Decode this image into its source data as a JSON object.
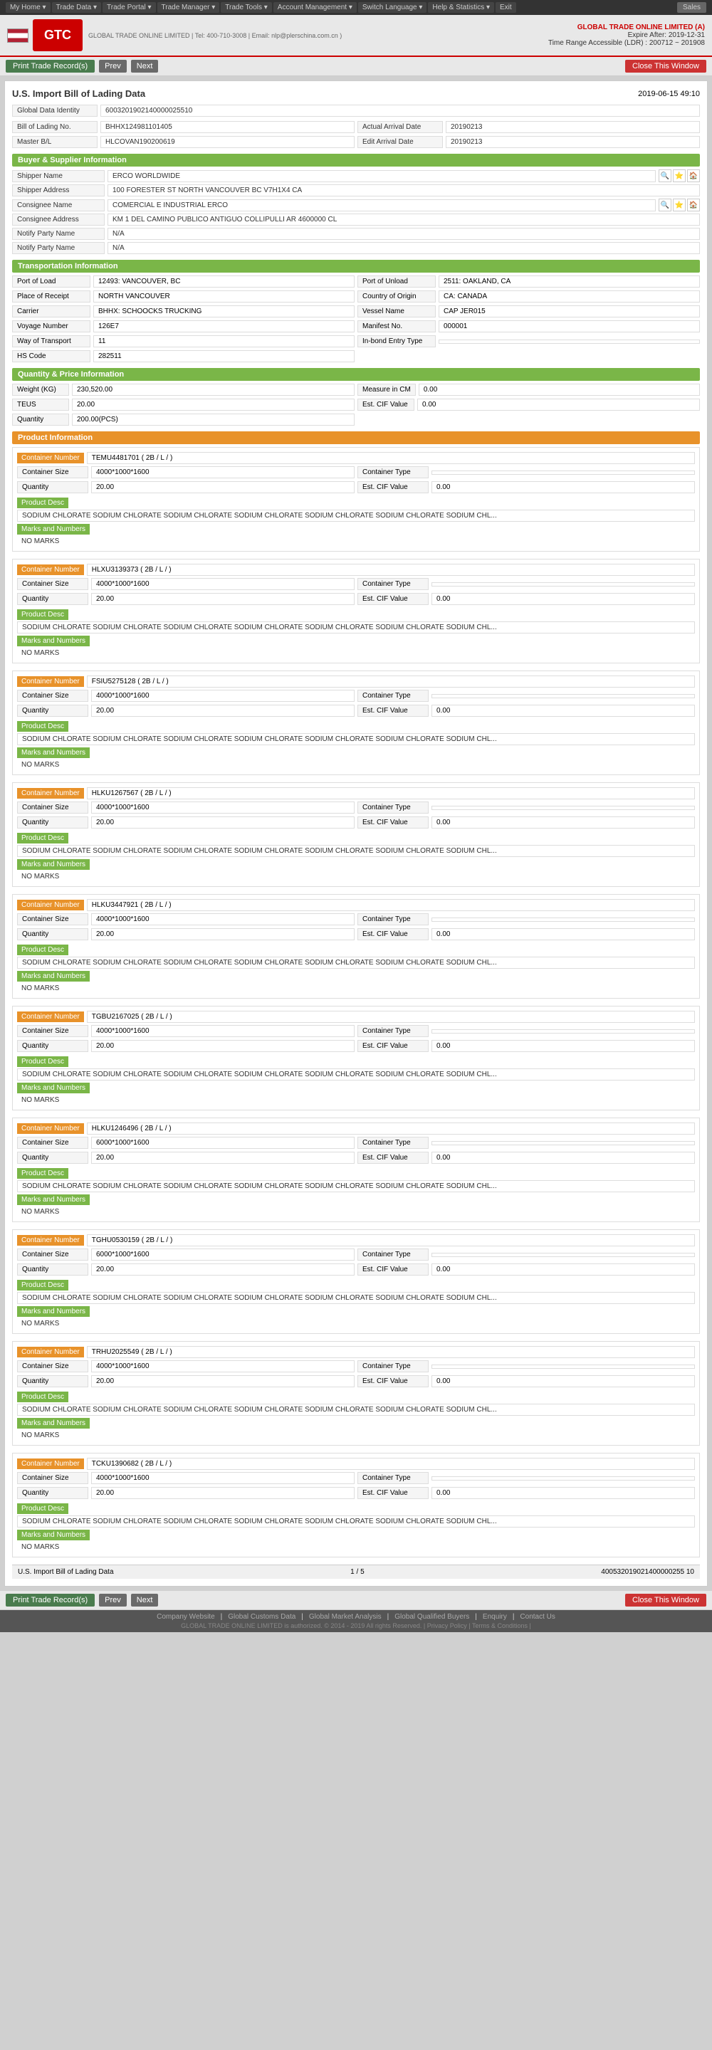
{
  "topNav": {
    "items": [
      "My Home",
      "Trade Data",
      "Trade Portal",
      "Trade Manager",
      "Trade Tools",
      "Account Management",
      "Switch Language",
      "Help & Statistics",
      "Exit"
    ],
    "sales": "Sales"
  },
  "header": {
    "companyName": "GLOBAL TRADE ONLINE LIMITED (A)",
    "expiry": "Expire After: 2019-12-31",
    "timeRange": "Time Range Accessible (LDR) : 200712 ~ 201908",
    "logo": "GTC",
    "companyFull": "GLOBAL TRADE ONLINE LIMITED | Tel: 400-710-3008 | Email: nlp@plerschina.com.cn )"
  },
  "pageTitle": "U.S. Import Bill of Lading Data",
  "toolbar": {
    "printLabel": "Print Trade Record(s)",
    "prevLabel": "Prev",
    "nextLabel": "Next",
    "closeLabel": "Close This Window"
  },
  "meta": {
    "date": "2019-06-15 49:10",
    "globalDataId": "6003201902140000025510"
  },
  "billInfo": {
    "billLabel": "Bill of Lading No.",
    "billValue": "BHHX124981101405",
    "masterLabel": "Master B/L",
    "masterValue": "HLCOVAN190200619",
    "actualArrivalLabel": "Actual Arrival Date",
    "actualArrivalValue": "20190213",
    "editArrivalLabel": "Edit Arrival Date",
    "editArrivalValue": "20190213"
  },
  "buyerSupplier": {
    "title": "Buyer & Supplier Information",
    "shipperLabel": "Shipper Name",
    "shipperValue": "ERCO WORLDWIDE",
    "shipperAddressLabel": "Shipper Address",
    "shipperAddressValue": "100 FORESTER ST NORTH VANCOUVER BC V7H1X4 CA",
    "consigneeLabel": "Consignee Name",
    "consigneeValue": "COMERCIAL E INDUSTRIAL ERCO",
    "consigneeAddressLabel": "Consignee Address",
    "consigneeAddressValue": "KM 1 DEL CAMINO PUBLICO ANTIGUO COLLIPULLI AR 4600000 CL",
    "notifyPartyLabel": "Notify Party Name",
    "notifyPartyValue": "N/A",
    "notifyParty2Label": "Notify Party Name",
    "notifyParty2Value": "N/A"
  },
  "transportation": {
    "title": "Transportation Information",
    "portLoadLabel": "Port of Load",
    "portLoadValue": "12493: VANCOUVER, BC",
    "portUnloadLabel": "Port of Unload",
    "portUnloadValue": "2511: OAKLAND, CA",
    "placeReceiptLabel": "Place of Receipt",
    "placeReceiptValue": "NORTH VANCOUVER",
    "countryOriginLabel": "Country of Origin",
    "countryOriginValue": "CA: CANADA",
    "carrierLabel": "Carrier",
    "carrierValue": "BHHX: SCHOOCKS TRUCKING",
    "vesselLabel": "Vessel Name",
    "vesselValue": "CAP JER015",
    "voyageLabel": "Voyage Number",
    "voyageValue": "126E7",
    "manifestLabel": "Manifest No.",
    "manifestValue": "000001",
    "wayTransportLabel": "Way of Transport",
    "wayTransportValue": "11",
    "inBondLabel": "In-bond Entry Type",
    "inBondValue": "",
    "hsLabel": "HS Code",
    "hsValue": "282511"
  },
  "quantity": {
    "title": "Quantity & Price Information",
    "weightLabel": "Weight (KG)",
    "weightValue": "230,520.00",
    "measureLabel": "Measure in CM",
    "measureValue": "0.00",
    "teusLabel": "TEUS",
    "teusValue": "20.00",
    "estCfvLabel": "Est. CIF Value",
    "estCfvValue": "0.00",
    "quantityLabel": "Quantity",
    "quantityValue": "200.00(PCS)"
  },
  "productInfo": {
    "title": "Product Information",
    "containers": [
      {
        "id": 1,
        "containerNumberLabel": "Container Number",
        "containerNumberValue": "TEMU4481701 ( 2B / L / )",
        "containerSizeLabel": "Container Size",
        "containerSizeValue": "4000*1000*1600",
        "containerTypeLabel": "Container Type",
        "containerTypeValue": "",
        "quantityLabel": "Quantity",
        "quantityValue": "20.00",
        "estCifLabel": "Est. CIF Value",
        "estCifValue": "0.00",
        "productDescLabel": "Product Desc",
        "productDescValue": "SODIUM CHLORATE SODIUM CHLORATE SODIUM CHLORATE SODIUM CHLORATE SODIUM CHLORATE SODIUM CHLORATE SODIUM CHL...",
        "marksLabel": "Marks and Numbers",
        "marksValue": "NO MARKS"
      },
      {
        "id": 2,
        "containerNumberLabel": "Container Number",
        "containerNumberValue": "HLXU3139373 ( 2B / L / )",
        "containerSizeLabel": "Container Size",
        "containerSizeValue": "4000*1000*1600",
        "containerTypeLabel": "Container Type",
        "containerTypeValue": "",
        "quantityLabel": "Quantity",
        "quantityValue": "20.00",
        "estCifLabel": "Est. CIF Value",
        "estCifValue": "0.00",
        "productDescLabel": "Product Desc",
        "productDescValue": "SODIUM CHLORATE SODIUM CHLORATE SODIUM CHLORATE SODIUM CHLORATE SODIUM CHLORATE SODIUM CHLORATE SODIUM CHL...",
        "marksLabel": "Marks and Numbers",
        "marksValue": "NO MARKS"
      },
      {
        "id": 3,
        "containerNumberLabel": "Container Number",
        "containerNumberValue": "FSIU5275128 ( 2B / L / )",
        "containerSizeLabel": "Container Size",
        "containerSizeValue": "4000*1000*1600",
        "containerTypeLabel": "Container Type",
        "containerTypeValue": "",
        "quantityLabel": "Quantity",
        "quantityValue": "20.00",
        "estCifLabel": "Est. CIF Value",
        "estCifValue": "0.00",
        "productDescLabel": "Product Desc",
        "productDescValue": "SODIUM CHLORATE SODIUM CHLORATE SODIUM CHLORATE SODIUM CHLORATE SODIUM CHLORATE SODIUM CHLORATE SODIUM CHL...",
        "marksLabel": "Marks and Numbers",
        "marksValue": "NO MARKS"
      },
      {
        "id": 4,
        "containerNumberLabel": "Container Number",
        "containerNumberValue": "HLKU1267567 ( 2B / L / )",
        "containerSizeLabel": "Container Size",
        "containerSizeValue": "4000*1000*1600",
        "containerTypeLabel": "Container Type",
        "containerTypeValue": "",
        "quantityLabel": "Quantity",
        "quantityValue": "20.00",
        "estCifLabel": "Est. CIF Value",
        "estCifValue": "0.00",
        "productDescLabel": "Product Desc",
        "productDescValue": "SODIUM CHLORATE SODIUM CHLORATE SODIUM CHLORATE SODIUM CHLORATE SODIUM CHLORATE SODIUM CHLORATE SODIUM CHL...",
        "marksLabel": "Marks and Numbers",
        "marksValue": "NO MARKS"
      },
      {
        "id": 5,
        "containerNumberLabel": "Container Number",
        "containerNumberValue": "HLKU3447921 ( 2B / L / )",
        "containerSizeLabel": "Container Size",
        "containerSizeValue": "4000*1000*1600",
        "containerTypeLabel": "Container Type",
        "containerTypeValue": "",
        "quantityLabel": "Quantity",
        "quantityValue": "20.00",
        "estCifLabel": "Est. CIF Value",
        "estCifValue": "0.00",
        "productDescLabel": "Product Desc",
        "productDescValue": "SODIUM CHLORATE SODIUM CHLORATE SODIUM CHLORATE SODIUM CHLORATE SODIUM CHLORATE SODIUM CHLORATE SODIUM CHL...",
        "marksLabel": "Marks and Numbers",
        "marksValue": "NO MARKS"
      },
      {
        "id": 6,
        "containerNumberLabel": "Container Number",
        "containerNumberValue": "TGBU2167025 ( 2B / L / )",
        "containerSizeLabel": "Container Size",
        "containerSizeValue": "4000*1000*1600",
        "containerTypeLabel": "Container Type",
        "containerTypeValue": "",
        "quantityLabel": "Quantity",
        "quantityValue": "20.00",
        "estCifLabel": "Est. CIF Value",
        "estCifValue": "0.00",
        "productDescLabel": "Product Desc",
        "productDescValue": "SODIUM CHLORATE SODIUM CHLORATE SODIUM CHLORATE SODIUM CHLORATE SODIUM CHLORATE SODIUM CHLORATE SODIUM CHL...",
        "marksLabel": "Marks and Numbers",
        "marksValue": "NO MARKS"
      },
      {
        "id": 7,
        "containerNumberLabel": "Container Number",
        "containerNumberValue": "HLKU1246496 ( 2B / L / )",
        "containerSizeLabel": "Container Size",
        "containerSizeValue": "6000*1000*1600",
        "containerTypeLabel": "Container Type",
        "containerTypeValue": "",
        "quantityLabel": "Quantity",
        "quantityValue": "20.00",
        "estCifLabel": "Est. CIF Value",
        "estCifValue": "0.00",
        "productDescLabel": "Product Desc",
        "productDescValue": "SODIUM CHLORATE SODIUM CHLORATE SODIUM CHLORATE SODIUM CHLORATE SODIUM CHLORATE SODIUM CHLORATE SODIUM CHL...",
        "marksLabel": "Marks and Numbers",
        "marksValue": "NO MARKS"
      },
      {
        "id": 8,
        "containerNumberLabel": "Container Number",
        "containerNumberValue": "TGHU0530159 ( 2B / L / )",
        "containerSizeLabel": "Container Size",
        "containerSizeValue": "6000*1000*1600",
        "containerTypeLabel": "Container Type",
        "containerTypeValue": "",
        "quantityLabel": "Quantity",
        "quantityValue": "20.00",
        "estCifLabel": "Est. CIF Value",
        "estCifValue": "0.00",
        "productDescLabel": "Product Desc",
        "productDescValue": "SODIUM CHLORATE SODIUM CHLORATE SODIUM CHLORATE SODIUM CHLORATE SODIUM CHLORATE SODIUM CHLORATE SODIUM CHL...",
        "marksLabel": "Marks and Numbers",
        "marksValue": "NO MARKS"
      },
      {
        "id": 9,
        "containerNumberLabel": "Container Number",
        "containerNumberValue": "TRHU2025549 ( 2B / L / )",
        "containerSizeLabel": "Container Size",
        "containerSizeValue": "4000*1000*1600",
        "containerTypeLabel": "Container Type",
        "containerTypeValue": "",
        "quantityLabel": "Quantity",
        "quantityValue": "20.00",
        "estCifLabel": "Est. CIF Value",
        "estCifValue": "0.00",
        "productDescLabel": "Product Desc",
        "productDescValue": "SODIUM CHLORATE SODIUM CHLORATE SODIUM CHLORATE SODIUM CHLORATE SODIUM CHLORATE SODIUM CHLORATE SODIUM CHL...",
        "marksLabel": "Marks and Numbers",
        "marksValue": "NO MARKS"
      },
      {
        "id": 10,
        "containerNumberLabel": "Container Number",
        "containerNumberValue": "TCKU1390682 ( 2B / L / )",
        "containerSizeLabel": "Container Size",
        "containerSizeValue": "4000*1000*1600",
        "containerTypeLabel": "Container Type",
        "containerTypeValue": "",
        "quantityLabel": "Quantity",
        "quantityValue": "20.00",
        "estCifLabel": "Est. CIF Value",
        "estCifValue": "0.00",
        "productDescLabel": "Product Desc",
        "productDescValue": "SODIUM CHLORATE SODIUM CHLORATE SODIUM CHLORATE SODIUM CHLORATE SODIUM CHLORATE SODIUM CHLORATE SODIUM CHL...",
        "marksLabel": "Marks and Numbers",
        "marksValue": "NO MARKS"
      }
    ]
  },
  "pageFooter": {
    "pageLabel": "U.S. Import Bill of Lading Data",
    "pageNumber": "1 / 5",
    "recordId": "400532019021400000255 10"
  },
  "bottomToolbar": {
    "printLabel": "Print Trade Record(s)",
    "prevLabel": "Prev",
    "nextLabel": "Next",
    "closeLabel": "Close This Window"
  },
  "footerLinks": [
    "Company Website",
    "Global Customs Data",
    "Global Market Analysis",
    "Global Qualified Buyers",
    "Enquiry",
    "Contact Us"
  ],
  "copyright": "GLOBAL TRADE ONLINE LIMITED is authorized. © 2014 - 2019 All rights Reserved. | Privacy Policy | Terms & Conditions |"
}
